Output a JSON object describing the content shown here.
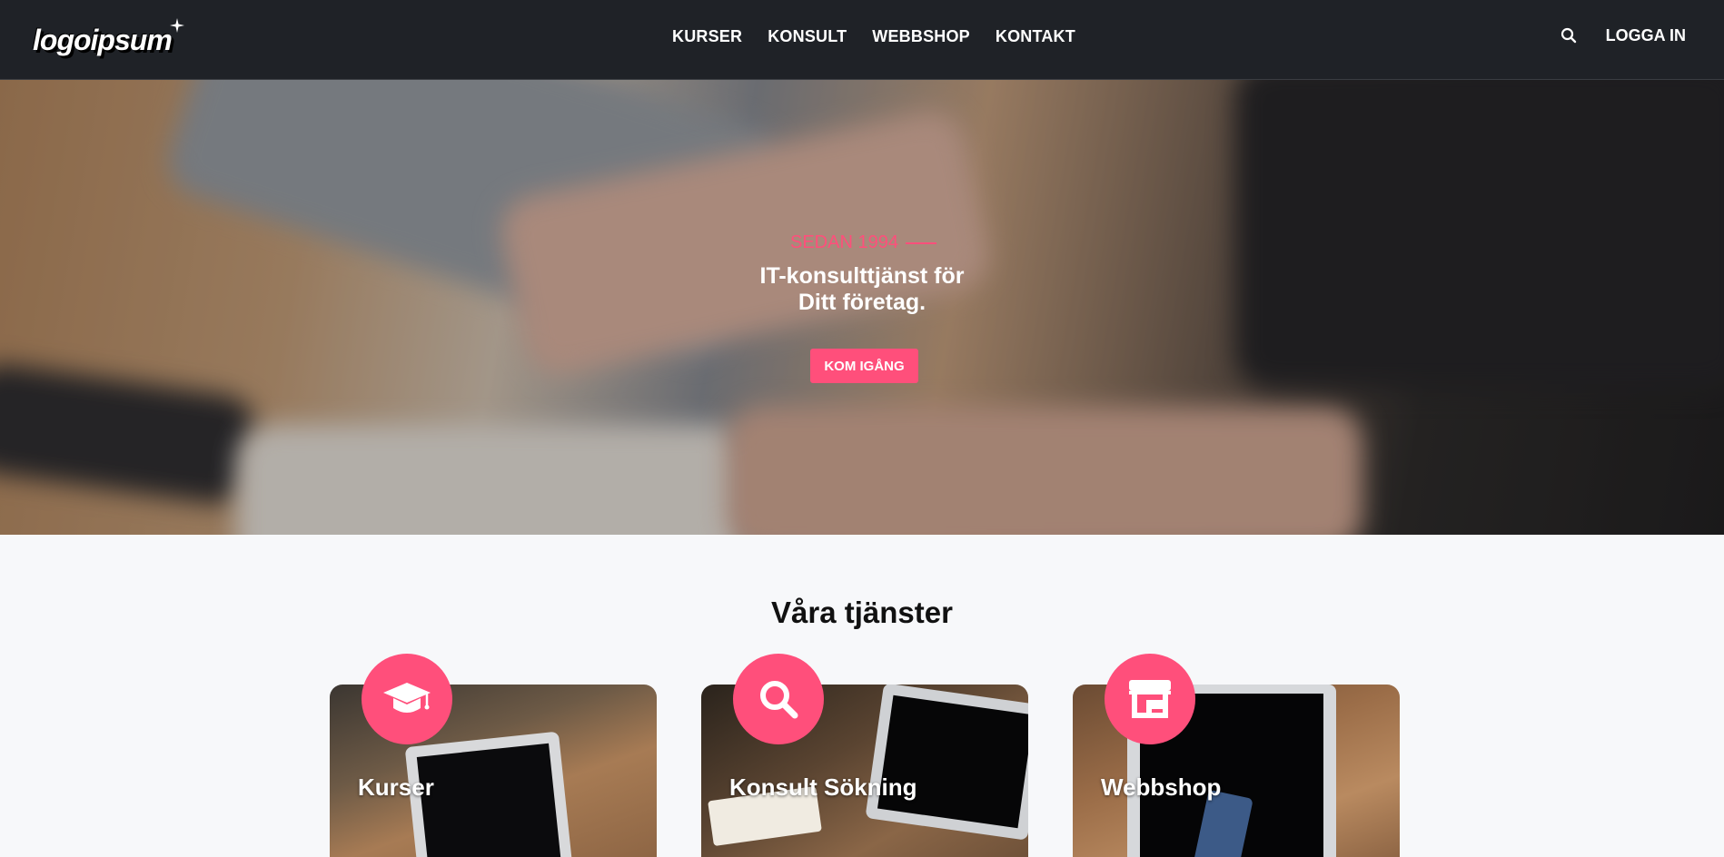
{
  "brand": {
    "logo_text": "logoipsum"
  },
  "nav": {
    "links": [
      {
        "label": "KURSER"
      },
      {
        "label": "KONSULT"
      },
      {
        "label": "WEBBSHOP"
      },
      {
        "label": "KONTAKT"
      }
    ],
    "login_label": "LOGGA IN"
  },
  "hero": {
    "eyebrow": "SEDAN 1994",
    "title_line1": "IT-konsulttjänst för",
    "title_line2": "Ditt företag.",
    "cta_label": "KOM IGÅNG"
  },
  "services": {
    "title": "Våra tjänster",
    "cards": [
      {
        "title": "Kurser",
        "icon": "graduation-cap-icon"
      },
      {
        "title": "Konsult Sökning",
        "icon": "search-icon"
      },
      {
        "title": "Webbshop",
        "icon": "store-icon"
      }
    ]
  },
  "colors": {
    "accent": "#ff4f7b",
    "navbar_bg": "#1f2227",
    "page_bg": "#f7f8fa"
  }
}
